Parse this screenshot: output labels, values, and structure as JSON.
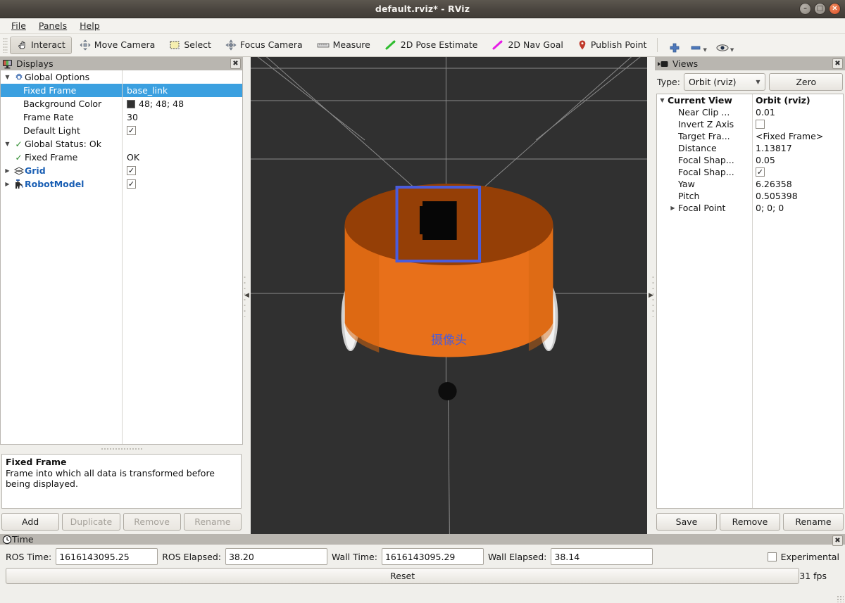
{
  "window": {
    "title": "default.rviz* - RViz",
    "buttons": {
      "minimize": "–",
      "maximize": "□",
      "close": "×"
    }
  },
  "menubar": {
    "items": [
      "File",
      "Panels",
      "Help"
    ]
  },
  "toolbar": {
    "items": [
      {
        "label": "Interact",
        "icon": "hand-cursor-icon",
        "active": true
      },
      {
        "label": "Move Camera",
        "icon": "move-camera-icon",
        "active": false
      },
      {
        "label": "Select",
        "icon": "select-rect-icon",
        "active": false
      },
      {
        "label": "Focus Camera",
        "icon": "focus-camera-icon",
        "active": false
      },
      {
        "label": "Measure",
        "icon": "ruler-icon",
        "active": false
      },
      {
        "label": "2D Pose Estimate",
        "icon": "green-arrow-icon",
        "active": false
      },
      {
        "label": "2D Nav Goal",
        "icon": "magenta-arrow-icon",
        "active": false
      },
      {
        "label": "Publish Point",
        "icon": "map-pin-icon",
        "active": false
      }
    ],
    "extra_icons": [
      "plus-icon",
      "minus-icon",
      "eye-icon"
    ]
  },
  "displays": {
    "title": "Displays",
    "close_label": "✖",
    "tree": [
      {
        "depth": 0,
        "expander": "down",
        "icon": "gear-icon",
        "name": "Global Options",
        "value": "",
        "value_type": "none",
        "selected": false,
        "bold": false
      },
      {
        "depth": 1,
        "expander": "none",
        "icon": "",
        "name": "Fixed Frame",
        "value": "base_link",
        "value_type": "text",
        "selected": true,
        "bold": false
      },
      {
        "depth": 1,
        "expander": "none",
        "icon": "",
        "name": "Background Color",
        "value": "48; 48; 48",
        "value_type": "color",
        "swatch": "#303030",
        "selected": false,
        "bold": false
      },
      {
        "depth": 1,
        "expander": "none",
        "icon": "",
        "name": "Frame Rate",
        "value": "30",
        "value_type": "text",
        "selected": false,
        "bold": false
      },
      {
        "depth": 1,
        "expander": "none",
        "icon": "",
        "name": "Default Light",
        "value": "✓",
        "value_type": "check",
        "selected": false,
        "bold": false
      },
      {
        "depth": 0,
        "expander": "down",
        "icon": "green-check-icon",
        "name": "Global Status: Ok",
        "value": "",
        "value_type": "none",
        "selected": false,
        "bold": false
      },
      {
        "depth": 1,
        "expander": "none",
        "icon": "green-check-icon",
        "name": "Fixed Frame",
        "value": "OK",
        "value_type": "text",
        "selected": false,
        "bold": false
      },
      {
        "depth": 0,
        "expander": "right",
        "icon": "grid-icon",
        "name": "Grid",
        "value": "✓",
        "value_type": "check",
        "selected": false,
        "bold": true
      },
      {
        "depth": 0,
        "expander": "right",
        "icon": "robot-icon",
        "name": "RobotModel",
        "value": "✓",
        "value_type": "check",
        "selected": false,
        "bold": true
      }
    ],
    "description": {
      "title": "Fixed Frame",
      "body": "Frame into which all data is transformed before being displayed."
    },
    "buttons": [
      {
        "label": "Add",
        "enabled": true
      },
      {
        "label": "Duplicate",
        "enabled": false
      },
      {
        "label": "Remove",
        "enabled": false
      },
      {
        "label": "Rename",
        "enabled": false
      }
    ]
  },
  "view3d": {
    "background_color": "#303030",
    "grid_color": "#9c9c9c",
    "robot": {
      "body_color": "#e8701a",
      "body_top_color": "#8f3c06",
      "camera_box_color": "#000000",
      "wheel_color": "#dedede",
      "caster_color": "#101010"
    },
    "marker_label": "摄像头",
    "marker_color": "#4a5cdb",
    "selection_box_color": "#4a5cdb"
  },
  "views": {
    "title": "Views",
    "close_label": "✖",
    "type_label": "Type:",
    "type_value": "Orbit (rviz)",
    "zero_label": "Zero",
    "tree": [
      {
        "depth": 0,
        "expander": "down",
        "name": "Current View",
        "value": "Orbit (rviz)",
        "value_type": "text",
        "bold": true
      },
      {
        "depth": 1,
        "expander": "none",
        "name": "Near Clip ...",
        "value": "0.01",
        "value_type": "text",
        "bold": false
      },
      {
        "depth": 1,
        "expander": "none",
        "name": "Invert Z Axis",
        "value": "",
        "value_type": "uncheck",
        "bold": false
      },
      {
        "depth": 1,
        "expander": "none",
        "name": "Target Fra...",
        "value": "<Fixed Frame>",
        "value_type": "text",
        "bold": false
      },
      {
        "depth": 1,
        "expander": "none",
        "name": "Distance",
        "value": "1.13817",
        "value_type": "text",
        "bold": false
      },
      {
        "depth": 1,
        "expander": "none",
        "name": "Focal Shap...",
        "value": "0.05",
        "value_type": "text",
        "bold": false
      },
      {
        "depth": 1,
        "expander": "none",
        "name": "Focal Shap...",
        "value": "✓",
        "value_type": "check",
        "bold": false
      },
      {
        "depth": 1,
        "expander": "none",
        "name": "Yaw",
        "value": "6.26358",
        "value_type": "text",
        "bold": false
      },
      {
        "depth": 1,
        "expander": "none",
        "name": "Pitch",
        "value": "0.505398",
        "value_type": "text",
        "bold": false
      },
      {
        "depth": 1,
        "expander": "right",
        "name": "Focal Point",
        "value": "0; 0; 0",
        "value_type": "text",
        "bold": false
      }
    ],
    "buttons": [
      {
        "label": "Save"
      },
      {
        "label": "Remove"
      },
      {
        "label": "Rename"
      }
    ]
  },
  "time": {
    "title": "Time",
    "close_label": "✖",
    "fields": [
      {
        "label": "ROS Time:",
        "value": "1616143095.25",
        "width": 145
      },
      {
        "label": "ROS Elapsed:",
        "value": "38.20",
        "width": 145
      },
      {
        "label": "Wall Time:",
        "value": "1616143095.29",
        "width": 145
      },
      {
        "label": "Wall Elapsed:",
        "value": "38.14",
        "width": 145
      }
    ],
    "experimental_label": "Experimental",
    "experimental_checked": false,
    "reset_label": "Reset",
    "fps": "31 fps"
  }
}
